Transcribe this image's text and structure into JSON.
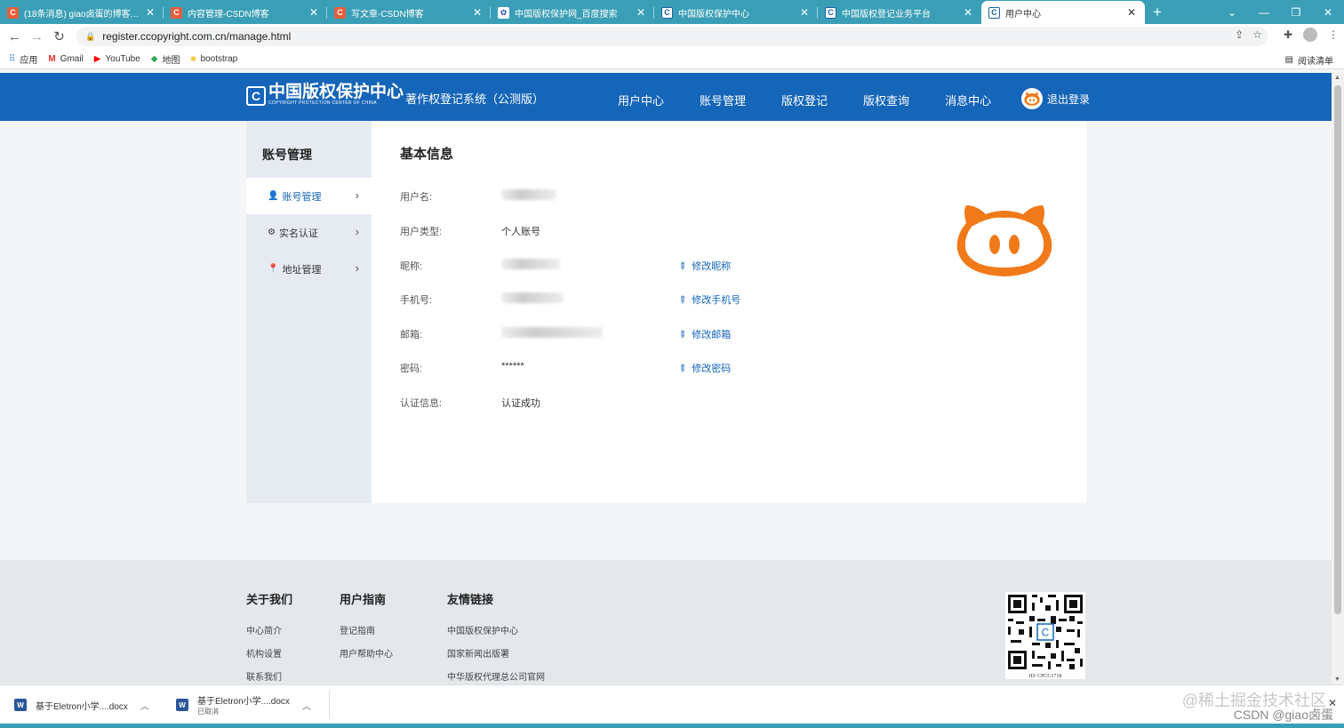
{
  "browser": {
    "tabs": [
      {
        "title": "(18条消息) giao卤蛋的博客_CSDN",
        "icon": "csdn-icon"
      },
      {
        "title": "内容管理-CSDN博客",
        "icon": "csdn-icon"
      },
      {
        "title": "写文章-CSDN博客",
        "icon": "csdn-icon"
      },
      {
        "title": "中国版权保护网_百度搜索",
        "icon": "baidu-icon"
      },
      {
        "title": "中国版权保护中心",
        "icon": "cc-icon"
      },
      {
        "title": "中国版权登记业务平台",
        "icon": "cc-icon"
      },
      {
        "title": "用户中心",
        "icon": "cc-icon"
      }
    ],
    "url": "register.ccopyright.com.cn/manage.html",
    "bookmarks": [
      {
        "label": "应用",
        "icon": "apps-icon"
      },
      {
        "label": "Gmail",
        "icon": "gmail-icon"
      },
      {
        "label": "YouTube",
        "icon": "youtube-icon"
      },
      {
        "label": "地图",
        "icon": "maps-icon"
      },
      {
        "label": "bootstrap",
        "icon": "folder-icon"
      }
    ],
    "reading_list": "阅读清单"
  },
  "header": {
    "logo_cn": "中国版权保护中心",
    "logo_en": "COPYRIGHT PROTECTION CENTER OF CHINA",
    "system_name": "著作权登记系统（公测版）",
    "nav": [
      "用户中心",
      "账号管理",
      "版权登记",
      "版权查询",
      "消息中心"
    ],
    "logout": "退出登录"
  },
  "sidebar": {
    "title": "账号管理",
    "items": [
      {
        "label": "账号管理",
        "icon": "user-icon"
      },
      {
        "label": "实名认证",
        "icon": "gear-icon"
      },
      {
        "label": "地址管理",
        "icon": "location-icon"
      }
    ]
  },
  "profile": {
    "title": "基本信息",
    "rows": [
      {
        "label": "用户名:",
        "value": "",
        "blurred": true
      },
      {
        "label": "用户类型:",
        "value": "个人账号"
      },
      {
        "label": "昵称:",
        "value": "",
        "blurred": true,
        "action": "修改昵称"
      },
      {
        "label": "手机号:",
        "value": "",
        "blurred": true,
        "action": "修改手机号"
      },
      {
        "label": "邮箱:",
        "value": "",
        "blurred": true,
        "action": "修改邮箱"
      },
      {
        "label": "密码:",
        "value": "******",
        "action": "修改密码"
      },
      {
        "label": "认证信息:",
        "value": "认证成功"
      }
    ]
  },
  "footer": {
    "columns": [
      {
        "heading": "关于我们",
        "links": [
          "中心简介",
          "机构设置",
          "联系我们"
        ]
      },
      {
        "heading": "用户指南",
        "links": [
          "登记指南",
          "用户帮助中心"
        ]
      },
      {
        "heading": "友情链接",
        "links": [
          "中国版权保护中心",
          "国家新闻出版署",
          "中华版权代理总公司官网"
        ]
      }
    ],
    "qr_id": "ID: CPCC1718"
  },
  "downloads": [
    {
      "name": "基于Eletron小学....docx",
      "status": ""
    },
    {
      "name": "基于Eletron小学....docx",
      "status": "已取消"
    }
  ],
  "watermark": {
    "line1": "@稀土掘金技术社区",
    "line2": "CSDN @giao卤蛋"
  },
  "colors": {
    "brand_blue": "#1565b8",
    "tab_bar": "#3a9fb6",
    "pig_orange": "#f07a1a"
  }
}
